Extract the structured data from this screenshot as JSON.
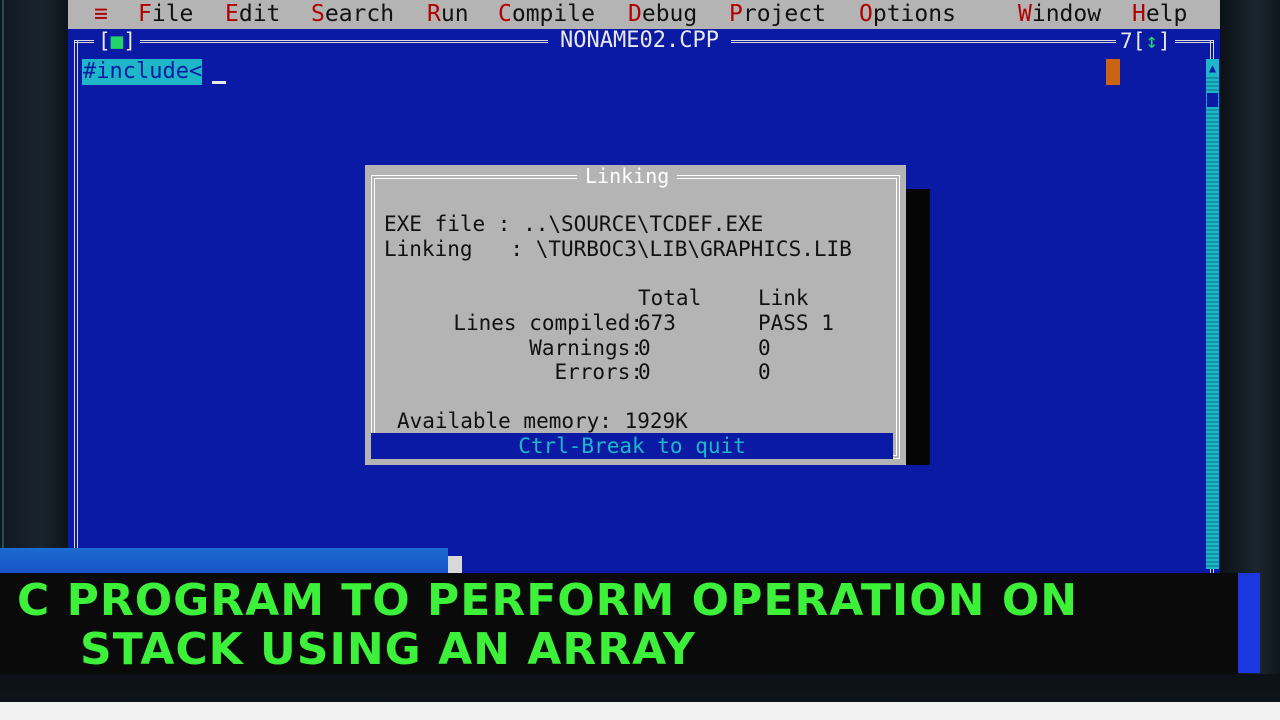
{
  "menubar": {
    "system_icon": "≡",
    "items": [
      {
        "hot": "F",
        "rest": "ile"
      },
      {
        "hot": "E",
        "rest": "dit"
      },
      {
        "hot": "S",
        "rest": "earch"
      },
      {
        "hot": "R",
        "rest": "un"
      },
      {
        "hot": "C",
        "rest": "ompile"
      },
      {
        "hot": "D",
        "rest": "ebug"
      },
      {
        "hot": "P",
        "rest": "roject"
      },
      {
        "hot": "O",
        "rest": "ptions"
      },
      {
        "hot": "W",
        "rest": "indow"
      },
      {
        "hot": "H",
        "rest": "elp"
      }
    ]
  },
  "editor": {
    "filename": "NONAME02.CPP",
    "close_open": "[",
    "close_mark": "■",
    "close_end": "]",
    "window_number": "7",
    "zoom_open": "[",
    "zoom_mark": "↕",
    "zoom_end": "]",
    "code_text": "#include<"
  },
  "dialog": {
    "title": "Linking",
    "exe_label": "EXE file : ",
    "exe_value": "..\\SOURCE\\TCDEF.EXE",
    "linking_label": "Linking   : ",
    "linking_value": "\\TURBOC3\\LIB\\GRAPHICS.LIB",
    "col_total": "Total",
    "col_link": "Link",
    "rows": [
      {
        "label": "Lines compiled:",
        "total": "673",
        "link": "PASS 1"
      },
      {
        "label": "Warnings:",
        "total": "0",
        "link": "0"
      },
      {
        "label": "Errors:",
        "total": "0",
        "link": "0"
      }
    ],
    "memory_label": "Available memory:",
    "memory_value": "1929K",
    "footer": "Ctrl-Break to quit"
  },
  "banner": {
    "line1": "C PROGRAM TO PERFORM OPERATION ON",
    "line2": "STACK USING AN ARRAY",
    "color": "#3df03a"
  },
  "colors": {
    "editor_bg": "#0a1aa4",
    "menu_bg": "#b4b4b4",
    "hotkey": "#b00000",
    "highlight": "#1eb7c8"
  }
}
